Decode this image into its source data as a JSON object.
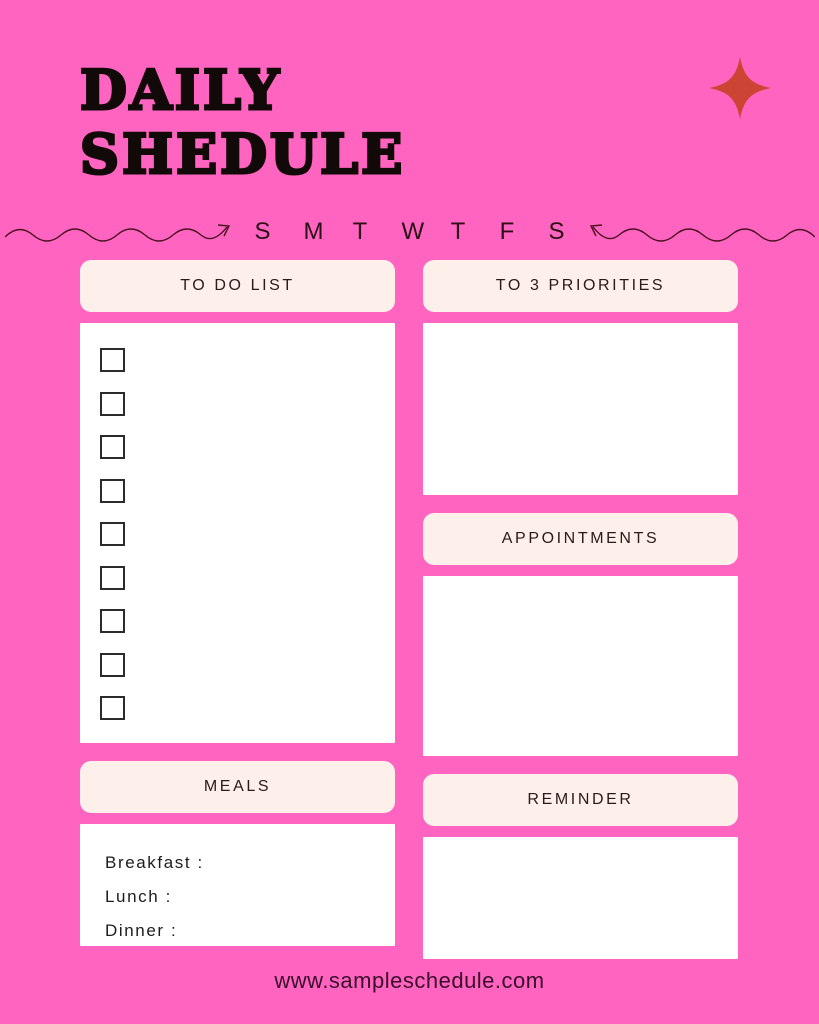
{
  "colors": {
    "background": "#FF64C0",
    "card_header": "#FDEFE9",
    "card_body": "#FFFFFF",
    "title_text": "#120A08",
    "sparkle": "#CC4433",
    "footer_text": "#3A0E2B",
    "squiggle": "#4A1020"
  },
  "header": {
    "title_line1": "DAILY",
    "title_line2": "SHEDULE",
    "sparkle_icon": "four-point-star-icon"
  },
  "days": {
    "letters": [
      "S",
      "M",
      "T",
      "W",
      "T",
      "F",
      "S"
    ],
    "left_decor": "squiggle-arrow-right-icon",
    "right_decor": "squiggle-arrow-left-icon"
  },
  "left_column": {
    "todo": {
      "header": "TO DO LIST",
      "checkbox_count": 9
    },
    "meals": {
      "header": "MEALS",
      "lines": [
        "Breakfast :",
        "Lunch :",
        "Dinner :"
      ]
    }
  },
  "right_column": {
    "priorities": {
      "header": "TO 3 PRIORITIES",
      "content": ""
    },
    "appointments": {
      "header": "APPOINTMENTS",
      "content": ""
    },
    "reminder": {
      "header": "REMINDER",
      "content": ""
    }
  },
  "footer": {
    "url": "www.sampleschedule.com"
  }
}
